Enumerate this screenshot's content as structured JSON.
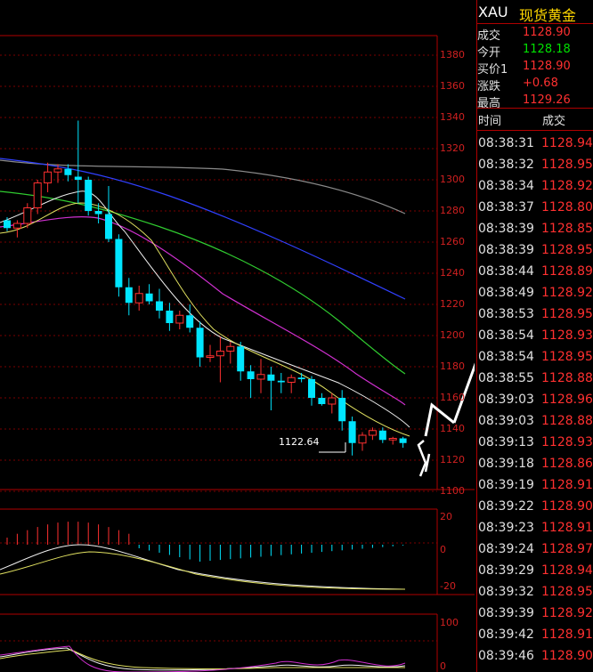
{
  "quote": {
    "symbol": "XAU",
    "name": "现货黄金",
    "rows": [
      {
        "label": "成交",
        "value": "1128.90",
        "color": "#ff3030"
      },
      {
        "label": "今开",
        "value": "1128.18",
        "color": "#00e000"
      },
      {
        "label": "买价1",
        "value": "1128.90",
        "color": "#ff3030"
      },
      {
        "label": "涨跌",
        "value": "+0.68",
        "color": "#ff3030"
      },
      {
        "label": "最高",
        "value": "1129.26",
        "color": "#ff3030"
      }
    ]
  },
  "ticks": {
    "header_time": "时间",
    "header_price": "成交",
    "rows": [
      {
        "time": "08:38:31",
        "price": "1128.94"
      },
      {
        "time": "08:38:32",
        "price": "1128.95"
      },
      {
        "time": "08:38:34",
        "price": "1128.92"
      },
      {
        "time": "08:38:37",
        "price": "1128.80"
      },
      {
        "time": "08:38:39",
        "price": "1128.85"
      },
      {
        "time": "08:38:39",
        "price": "1128.95"
      },
      {
        "time": "08:38:44",
        "price": "1128.89"
      },
      {
        "time": "08:38:49",
        "price": "1128.92"
      },
      {
        "time": "08:38:53",
        "price": "1128.95"
      },
      {
        "time": "08:38:54",
        "price": "1128.93"
      },
      {
        "time": "08:38:54",
        "price": "1128.95"
      },
      {
        "time": "08:38:55",
        "price": "1128.88"
      },
      {
        "time": "08:39:03",
        "price": "1128.96"
      },
      {
        "time": "08:39:03",
        "price": "1128.88"
      },
      {
        "time": "08:39:13",
        "price": "1128.93"
      },
      {
        "time": "08:39:18",
        "price": "1128.86"
      },
      {
        "time": "08:39:19",
        "price": "1128.91"
      },
      {
        "time": "08:39:22",
        "price": "1128.90"
      },
      {
        "time": "08:39:23",
        "price": "1128.91"
      },
      {
        "time": "08:39:24",
        "price": "1128.97"
      },
      {
        "time": "08:39:29",
        "price": "1128.94"
      },
      {
        "time": "08:39:32",
        "price": "1128.95"
      },
      {
        "time": "08:39:39",
        "price": "1128.92"
      },
      {
        "time": "08:39:42",
        "price": "1128.91"
      },
      {
        "time": "08:39:46",
        "price": "1128.90"
      }
    ]
  },
  "chart": {
    "price_ticks": [
      "1380",
      "1360",
      "1340",
      "1320",
      "1300",
      "1280",
      "1260",
      "1240",
      "1220",
      "1200",
      "1180",
      "1160",
      "1140",
      "1120",
      "1100"
    ],
    "low_label": "1122.64",
    "macd_ticks": [
      "20",
      "0",
      "-20"
    ],
    "kdj_ticks": [
      "100",
      "0"
    ],
    "colors": {
      "up": "#ff3030",
      "down": "#00e5ff",
      "grid": "#8b0000",
      "axis": "#d02020"
    },
    "candles": [
      {
        "o": 1274,
        "h": 1276,
        "l": 1267,
        "c": 1269
      },
      {
        "o": 1269,
        "h": 1274,
        "l": 1263,
        "c": 1272
      },
      {
        "o": 1272,
        "h": 1285,
        "l": 1269,
        "c": 1282
      },
      {
        "o": 1282,
        "h": 1300,
        "l": 1278,
        "c": 1298
      },
      {
        "o": 1298,
        "h": 1311,
        "l": 1292,
        "c": 1305
      },
      {
        "o": 1305,
        "h": 1310,
        "l": 1298,
        "c": 1307
      },
      {
        "o": 1307,
        "h": 1310,
        "l": 1299,
        "c": 1303
      },
      {
        "o": 1302,
        "h": 1338,
        "l": 1285,
        "c": 1300
      },
      {
        "o": 1300,
        "h": 1302,
        "l": 1277,
        "c": 1280
      },
      {
        "o": 1280,
        "h": 1285,
        "l": 1272,
        "c": 1278
      },
      {
        "o": 1278,
        "h": 1296,
        "l": 1260,
        "c": 1262
      },
      {
        "o": 1262,
        "h": 1265,
        "l": 1225,
        "c": 1231
      },
      {
        "o": 1231,
        "h": 1237,
        "l": 1213,
        "c": 1221
      },
      {
        "o": 1221,
        "h": 1232,
        "l": 1216,
        "c": 1227
      },
      {
        "o": 1227,
        "h": 1233,
        "l": 1220,
        "c": 1222
      },
      {
        "o": 1222,
        "h": 1230,
        "l": 1211,
        "c": 1216
      },
      {
        "o": 1216,
        "h": 1221,
        "l": 1203,
        "c": 1208
      },
      {
        "o": 1208,
        "h": 1216,
        "l": 1204,
        "c": 1213
      },
      {
        "o": 1213,
        "h": 1220,
        "l": 1202,
        "c": 1205
      },
      {
        "o": 1205,
        "h": 1209,
        "l": 1180,
        "c": 1186
      },
      {
        "o": 1186,
        "h": 1194,
        "l": 1183,
        "c": 1187
      },
      {
        "o": 1187,
        "h": 1199,
        "l": 1170,
        "c": 1190
      },
      {
        "o": 1190,
        "h": 1196,
        "l": 1182,
        "c": 1193
      },
      {
        "o": 1193,
        "h": 1196,
        "l": 1171,
        "c": 1177
      },
      {
        "o": 1177,
        "h": 1181,
        "l": 1160,
        "c": 1172
      },
      {
        "o": 1172,
        "h": 1185,
        "l": 1163,
        "c": 1175
      },
      {
        "o": 1175,
        "h": 1180,
        "l": 1152,
        "c": 1171
      },
      {
        "o": 1171,
        "h": 1176,
        "l": 1163,
        "c": 1170
      },
      {
        "o": 1170,
        "h": 1175,
        "l": 1163,
        "c": 1173
      },
      {
        "o": 1173,
        "h": 1176,
        "l": 1170,
        "c": 1172
      },
      {
        "o": 1172,
        "h": 1174,
        "l": 1155,
        "c": 1160
      },
      {
        "o": 1160,
        "h": 1163,
        "l": 1155,
        "c": 1156
      },
      {
        "o": 1156,
        "h": 1163,
        "l": 1150,
        "c": 1160
      },
      {
        "o": 1160,
        "h": 1165,
        "l": 1139,
        "c": 1145
      },
      {
        "o": 1145,
        "h": 1148,
        "l": 1123,
        "c": 1131
      },
      {
        "o": 1131,
        "h": 1138,
        "l": 1126,
        "c": 1136
      },
      {
        "o": 1136,
        "h": 1141,
        "l": 1133,
        "c": 1139
      },
      {
        "o": 1139,
        "h": 1141,
        "l": 1131,
        "c": 1133
      },
      {
        "o": 1133,
        "h": 1135,
        "l": 1130,
        "c": 1134
      },
      {
        "o": 1134,
        "h": 1135,
        "l": 1128,
        "c": 1131
      }
    ]
  }
}
